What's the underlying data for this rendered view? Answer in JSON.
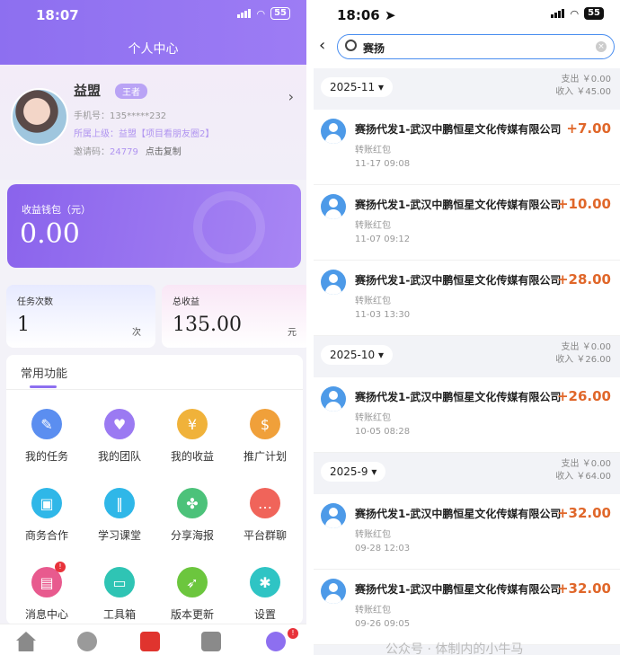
{
  "left": {
    "status": {
      "time": "18:07",
      "battery": "55"
    },
    "title": "个人中心",
    "profile": {
      "name": "益盟",
      "badge": "王者",
      "phone": "手机号：135*****232",
      "parent_label": "所属上级：",
      "parent_value": "益盟【项目看朋友圈2】",
      "invite_label": "邀请码：",
      "invite_code": "24779",
      "copy_label": "点击复制"
    },
    "wallet": {
      "label": "收益钱包（元）",
      "value": "0.00"
    },
    "tasks": {
      "label": "任务次数",
      "value": "1",
      "unit": "次"
    },
    "income": {
      "label": "总收益",
      "value": "135.00",
      "unit": "元"
    },
    "functions": {
      "title": "常用功能",
      "items": [
        {
          "label": "我的任务",
          "icon": "task-icon",
          "color": "#5b8ef0"
        },
        {
          "label": "我的团队",
          "icon": "team-heart-icon",
          "color": "#9b7af2"
        },
        {
          "label": "我的收益",
          "icon": "coin-bag-icon",
          "color": "#f0b23a"
        },
        {
          "label": "推广计划",
          "icon": "money-hand-icon",
          "color": "#f0a03a"
        },
        {
          "label": "商务合作",
          "icon": "badge-card-icon",
          "color": "#2fb7e8"
        },
        {
          "label": "学习课堂",
          "icon": "bars-icon",
          "color": "#2fb7e8"
        },
        {
          "label": "分享海报",
          "icon": "clover-icon",
          "color": "#4cc27a"
        },
        {
          "label": "平台群聊",
          "icon": "chat-icon",
          "color": "#f0645a"
        },
        {
          "label": "消息中心",
          "icon": "message-icon",
          "color": "#e85a8e",
          "badge": "!"
        },
        {
          "label": "工具箱",
          "icon": "toolbox-icon",
          "color": "#2fc4b4"
        },
        {
          "label": "版本更新",
          "icon": "rocket-icon",
          "color": "#6cc63e"
        },
        {
          "label": "设置",
          "icon": "gear-icon",
          "color": "#2fc4c4"
        }
      ]
    }
  },
  "right": {
    "status": {
      "time": "18:06",
      "battery": "55"
    },
    "search": {
      "value": "赛扬"
    },
    "months": [
      {
        "label": "2025-11",
        "out": "支出 ￥0.00",
        "in": "收入 ￥45.00",
        "rows": [
          {
            "name": "赛扬代发1-武汉中鹏恒星文化传媒有限公司",
            "amount": "+7.00",
            "type": "转账红包",
            "date": "11-17 09:08"
          },
          {
            "name": "赛扬代发1-武汉中鹏恒星文化传媒有限公司",
            "amount": "+10.00",
            "type": "转账红包",
            "date": "11-07 09:12"
          },
          {
            "name": "赛扬代发1-武汉中鹏恒星文化传媒有限公司",
            "amount": "+28.00",
            "type": "转账红包",
            "date": "11-03 13:30"
          }
        ]
      },
      {
        "label": "2025-10",
        "out": "支出 ￥0.00",
        "in": "收入 ￥26.00",
        "rows": [
          {
            "name": "赛扬代发1-武汉中鹏恒星文化传媒有限公司",
            "amount": "+26.00",
            "type": "转账红包",
            "date": "10-05 08:28"
          }
        ]
      },
      {
        "label": "2025-9",
        "out": "支出 ￥0.00",
        "in": "收入 ￥64.00",
        "rows": [
          {
            "name": "赛扬代发1-武汉中鹏恒星文化传媒有限公司",
            "amount": "+32.00",
            "type": "转账红包",
            "date": "09-28 12:03"
          },
          {
            "name": "赛扬代发1-武汉中鹏恒星文化传媒有限公司",
            "amount": "+32.00",
            "type": "转账红包",
            "date": "09-26 09:05"
          }
        ]
      }
    ],
    "watermark": "公众号 · 体制内的小牛马"
  }
}
